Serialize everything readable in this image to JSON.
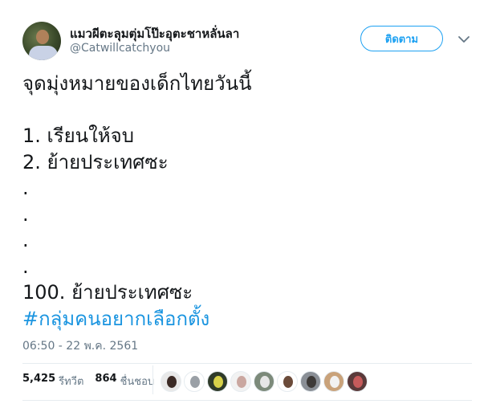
{
  "tweet": {
    "display_name": "แมวผีตะลุมตุ่มโป๊ะอุตะชาหลั่นลา",
    "handle": "@Catwillcatchyou",
    "follow_label": "ติดตาม",
    "lines": [
      "จุดมุ่งหมายของเด็กไทยวันนี้",
      "",
      "1. เรียนให้จบ",
      "2. ย้ายประเทศซะ",
      ".",
      ".",
      ".",
      ".",
      "100. ย้ายประเทศซะ"
    ],
    "hashtag": "#กลุ่มคนอยากเลือกตั้ง",
    "timestamp": "06:50 - 22 พ.ค. 2561",
    "retweets_count": "5,425",
    "retweets_label": "รีทวีต",
    "likes_count": "864",
    "likes_label": "ชื่นชอบ"
  },
  "colors": {
    "accent": "#1da1f2",
    "hashtag": "#1b95e0",
    "secondary_text": "#657786",
    "divider": "#e6ecf0"
  },
  "icons": {
    "menu": "chevron-down-icon"
  },
  "liker_avatars": [
    {
      "bg": "#e8e8e8",
      "fg": "#3b2a25"
    },
    {
      "bg": "#ffffff",
      "fg": "#9aa0a6"
    },
    {
      "bg": "#2f3b2a",
      "fg": "#d8d24a"
    },
    {
      "bg": "#f2f2f2",
      "fg": "#caa7a0"
    },
    {
      "bg": "#7c8a7a",
      "fg": "#e6e6e6"
    },
    {
      "bg": "#ffffff",
      "fg": "#6b4b3a"
    },
    {
      "bg": "#8a8f96",
      "fg": "#3d3a38"
    },
    {
      "bg": "#c9a27a",
      "fg": "#f2f2f2"
    },
    {
      "bg": "#5a3a3a",
      "fg": "#c65b5b"
    }
  ]
}
